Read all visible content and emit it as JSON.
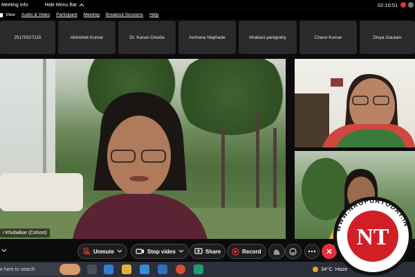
{
  "topbar": {
    "meeting_info": "Meeting Info",
    "hide_menu_bar": "Hide Menu Bar",
    "clock": "02:10:51"
  },
  "menubar": {
    "items": [
      "View",
      "Audio & Video",
      "Participant",
      "Meeting",
      "Breakout Sessions",
      "Help"
    ]
  },
  "participants_strip": [
    "25170527115",
    "Abhishek Kumar",
    "Dr. Kanan Divetia",
    "Archana Naphade",
    "bhabani panigrahy",
    "Charvi Kumar",
    "Divya Gautam"
  ],
  "main_video": {
    "name_label": "i Khubalkar (Cohost)"
  },
  "controls": {
    "unmute": "Unmute",
    "stop_video": "Stop video",
    "share": "Share",
    "record": "Record"
  },
  "taskbar": {
    "search_placeholder": "e here to search",
    "temperature": "34°C",
    "weather": "Haze"
  },
  "watermark": {
    "text": "WWW.NAGPURTODAY.IN",
    "logo": "NT"
  },
  "colors": {
    "leave_red": "#e5303b",
    "record_red": "#e5303b",
    "unmute_red": "#e5303b",
    "background": "#0b0b0c"
  }
}
